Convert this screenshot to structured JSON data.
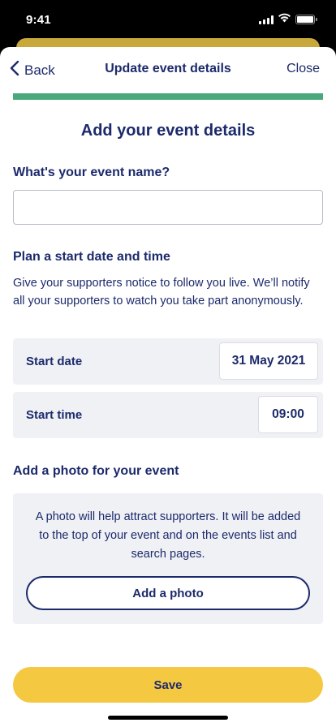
{
  "status_bar": {
    "time": "9:41",
    "icons": [
      "cellular-signal-icon",
      "wifi-icon",
      "battery-icon"
    ]
  },
  "nav": {
    "back_label": "Back",
    "title": "Update event details",
    "close_label": "Close"
  },
  "progress": {
    "value_percent": 100,
    "color": "#4aa97c"
  },
  "form": {
    "heading": "Add your event details",
    "event_name": {
      "label": "What's your event name?",
      "value": "",
      "placeholder": ""
    },
    "schedule": {
      "title": "Plan a start date and time",
      "description": "Give your supporters notice to follow you live. We’ll notify all your supporters to watch you take part anonymously.",
      "start_date": {
        "label": "Start date",
        "value": "31 May 2021"
      },
      "start_time": {
        "label": "Start time",
        "value": "09:00"
      }
    },
    "photo": {
      "title": "Add a photo for your event",
      "description": "A photo will help attract supporters. It will be added to the top of your event and on the events list and search pages.",
      "button_label": "Add a photo"
    }
  },
  "footer": {
    "save_label": "Save"
  },
  "colors": {
    "brand_navy": "#1c2a6b",
    "accent_yellow": "#f5c842",
    "progress_green": "#4aa97c",
    "panel_gray": "#eff1f5"
  }
}
